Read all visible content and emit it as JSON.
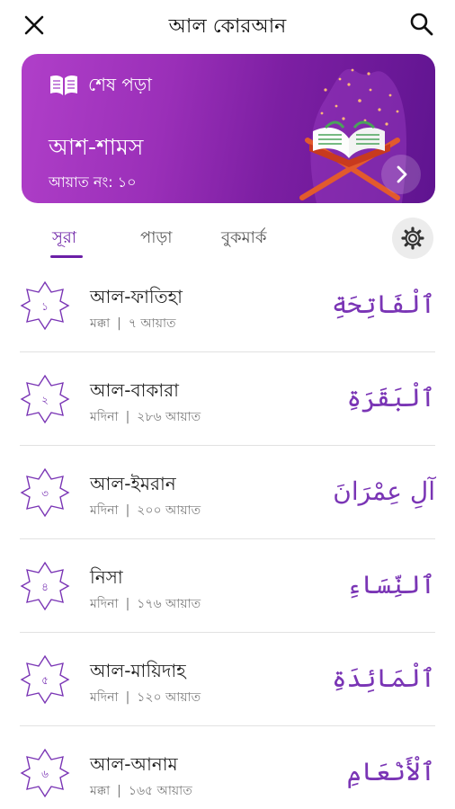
{
  "topbar": {
    "title": "আল কোরআন",
    "close_icon": "close-icon",
    "search_icon": "search-icon"
  },
  "last_read": {
    "label": "শেষ পড়া",
    "surah": "আশ-শামস",
    "ayah": "আয়াত নং: ১০",
    "accent_start": "#b03fc9",
    "accent_end": "#5f1490"
  },
  "tabs": [
    {
      "label": "সূরা",
      "active": true
    },
    {
      "label": "পাড়া",
      "active": false
    },
    {
      "label": "বুকমার্ক",
      "active": false
    }
  ],
  "surahs": [
    {
      "number": "১",
      "name": "আল-ফাতিহা",
      "place": "মক্কা",
      "ayahs": "৭ আয়াত",
      "arabic": "ٱلْفَاتِحَةِ"
    },
    {
      "number": "২",
      "name": "আল-বাকারা",
      "place": "মদিনা",
      "ayahs": "২৮৬ আয়াত",
      "arabic": "ٱلْبَقَرَةِ"
    },
    {
      "number": "৩",
      "name": "আল-ইমরান",
      "place": "মদিনা",
      "ayahs": "২০০ আয়াত",
      "arabic": "آلِ عِمْرَانَ"
    },
    {
      "number": "৪",
      "name": "নিসা",
      "place": "মদিনা",
      "ayahs": "১৭৬ আয়াত",
      "arabic": "ٱلنِّسَاءِ"
    },
    {
      "number": "৫",
      "name": "আল-মায়িদাহ",
      "place": "মদিনা",
      "ayahs": "১২০ আয়াত",
      "arabic": "ٱلْمَائِدَةِ"
    },
    {
      "number": "৬",
      "name": "আল-আনাম",
      "place": "মক্কা",
      "ayahs": "১৬৫ আয়াত",
      "arabic": "ٱلْأَنْعَامِ"
    }
  ],
  "separator": "|",
  "colors": {
    "accent": "#6b1fa6",
    "arabic_text": "#7a35b5",
    "divider": "#e2e2e2"
  }
}
